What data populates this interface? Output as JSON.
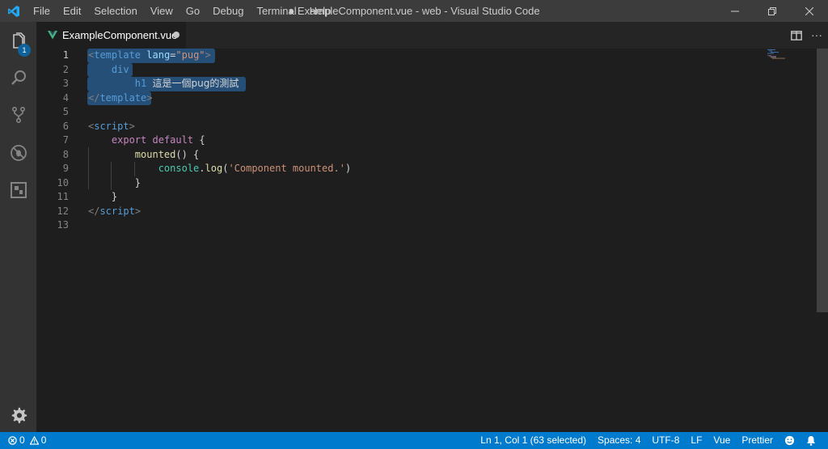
{
  "titlebar": {
    "menu": [
      "File",
      "Edit",
      "Selection",
      "View",
      "Go",
      "Debug",
      "Terminal",
      "Help"
    ],
    "title": "● ExampleComponent.vue - web - Visual Studio Code"
  },
  "activitybar": {
    "items": [
      "files-icon",
      "search-icon",
      "source-control-icon",
      "debug-icon",
      "extensions-icon"
    ],
    "explorer_badge": "1",
    "settings": "gear-icon"
  },
  "tab": {
    "label": "ExampleComponent.vue",
    "dirty": true
  },
  "editor": {
    "line_numbers": [
      "1",
      "2",
      "3",
      "4",
      "5",
      "6",
      "7",
      "8",
      "9",
      "10",
      "11",
      "12",
      "13"
    ],
    "lines": {
      "l1": {
        "open": "<",
        "tag": "template",
        "attr": "lang",
        "eq": "=",
        "val": "\"pug\"",
        "close": ">"
      },
      "l2": {
        "text": "div"
      },
      "l3": {
        "tag": "h1",
        "text": "這是一個pug的測試"
      },
      "l4": {
        "open": "</",
        "tag": "template",
        "close": ">"
      },
      "l6": {
        "open": "<",
        "tag": "script",
        "close": ">"
      },
      "l7": {
        "kw1": "export",
        "kw2": "default",
        "punc": "{"
      },
      "l8": {
        "fn": "mounted",
        "punc": "() {"
      },
      "l9": {
        "obj": "console",
        "dot": ".",
        "fn": "log",
        "p1": "(",
        "str": "'Component mounted.'",
        "p2": ")"
      },
      "l10": {
        "punc": "}"
      },
      "l11": {
        "punc": "}"
      },
      "l12": {
        "open": "</",
        "tag": "script",
        "close": ">"
      }
    }
  },
  "statusbar": {
    "errors": "0",
    "warnings": "0",
    "position": "Ln 1, Col 1 (63 selected)",
    "spaces": "Spaces: 4",
    "encoding": "UTF-8",
    "eol": "LF",
    "language": "Vue",
    "formatter": "Prettier"
  },
  "colors": {
    "statusbar": "#007acc",
    "titlebar": "#3c3c3c",
    "activitybar": "#333333",
    "editor": "#1e1e1e",
    "selection": "#264f78"
  }
}
